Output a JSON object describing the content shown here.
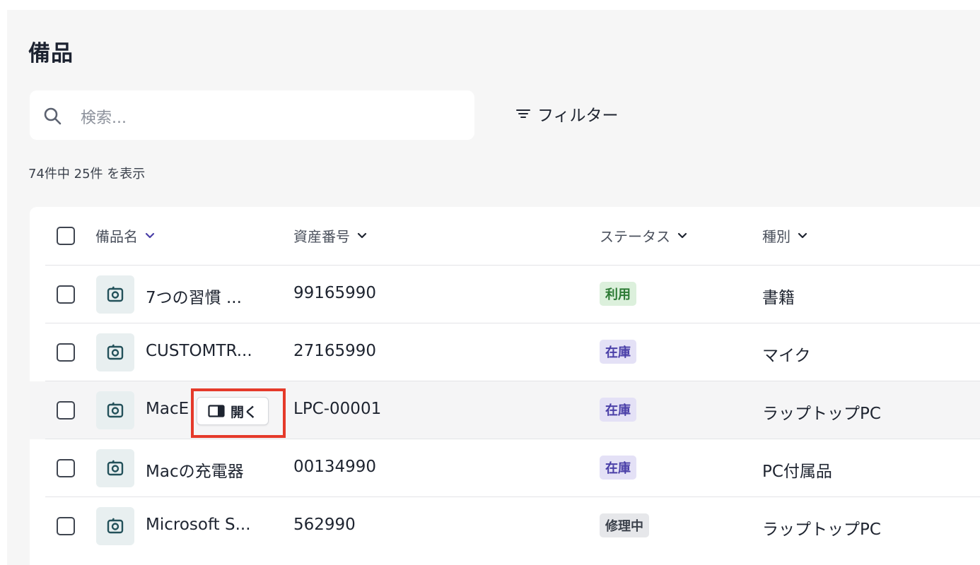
{
  "page": {
    "title": "備品"
  },
  "search": {
    "placeholder": "検索..."
  },
  "filter": {
    "label": "フィルター"
  },
  "result_count": "74件中 25件 を表示",
  "table": {
    "columns": [
      {
        "label": "備品名"
      },
      {
        "label": "資産番号"
      },
      {
        "label": "ステータス"
      },
      {
        "label": "種別"
      }
    ],
    "rows": [
      {
        "name": "7つの習慣 ...",
        "asset_no": "99165990",
        "status": "利用",
        "status_color": "#2c7a34",
        "category": "書籍"
      },
      {
        "name": "CUSTOMTR...",
        "asset_no": "27165990",
        "status": "在庫",
        "status_color": "#4a3fa8",
        "category": "マイク"
      },
      {
        "name": "MacE",
        "asset_no": "LPC-00001",
        "status": "在庫",
        "status_color": "#4a3fa8",
        "category": "ラップトップPC",
        "hovered": true
      },
      {
        "name": "Macの充電器",
        "asset_no": "00134990",
        "status": "在庫",
        "status_color": "#4a3fa8",
        "category": "PC付属品"
      },
      {
        "name": "Microsoft S...",
        "asset_no": "562990",
        "status": "修理中",
        "status_color": "#3c424c",
        "category": "ラップトップPC"
      }
    ],
    "open_button": {
      "label": "開く",
      "icon": "side-panel-icon"
    }
  },
  "colors": {
    "highlight": "#e53a2a",
    "background": "#f6f6f6"
  }
}
